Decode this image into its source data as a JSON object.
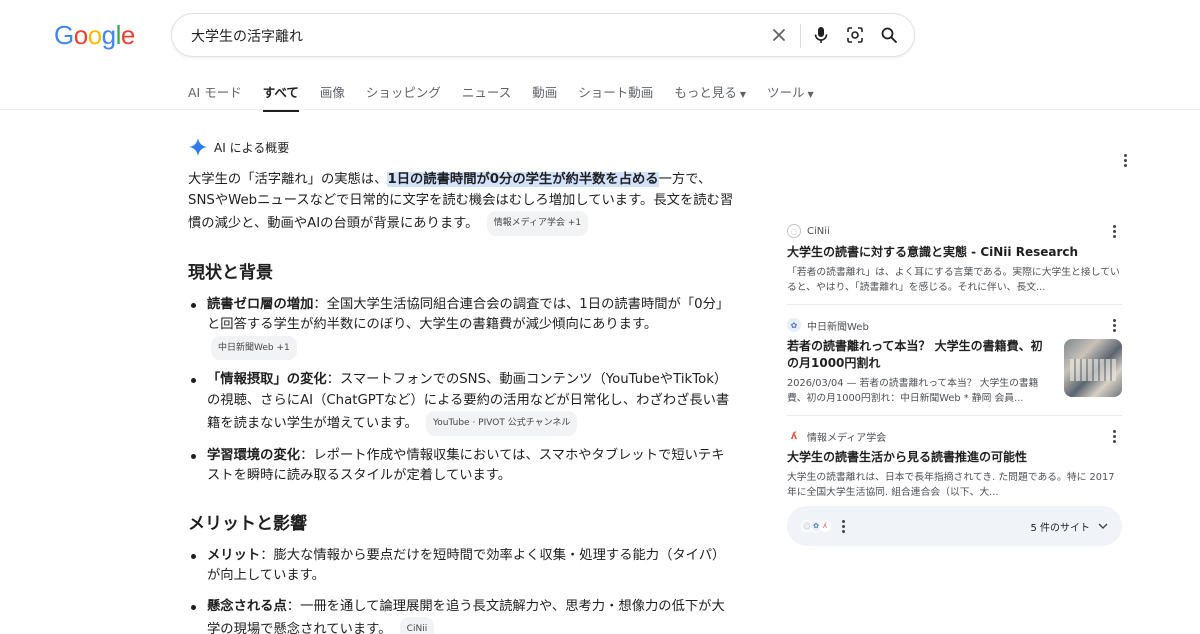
{
  "logo": {
    "text": "Google",
    "colors": [
      "#4285F4",
      "#EA4335",
      "#FBBC05",
      "#4285F4",
      "#34A853",
      "#EA4335"
    ]
  },
  "search": {
    "query": "大学生の活字離れ"
  },
  "tabs": [
    {
      "label": "AI モード"
    },
    {
      "label": "すべて",
      "active": true
    },
    {
      "label": "画像"
    },
    {
      "label": "ショッピング"
    },
    {
      "label": "ニュース"
    },
    {
      "label": "動画"
    },
    {
      "label": "ショート動画"
    },
    {
      "label": "もっと見る"
    },
    {
      "label": "ツール"
    }
  ],
  "ai_overview": {
    "title": "AI による概要",
    "intro_before": "大学生の「活字離れ」の実態は、",
    "intro_highlight": "1日の読書時間が0分の学生が約半数を占める",
    "intro_after": "一方で、SNSやWebニュースなどで日常的に文字を読む機会はむしろ増加しています。長文を読む習慣の減少と、動画やAIの台頭が背景にあります。",
    "intro_chip": "情報メディア学会 +1",
    "section1": {
      "heading": "現状と背景",
      "items": [
        {
          "bold": "読書ゼロ層の増加",
          "text": "：全国大学生活協同組合連合会の調査では、1日の読書時間が「0分」と回答する学生が約半数にのぼり、大学生の書籍費が減少傾向にあります。",
          "chip": "中日新聞Web +1"
        },
        {
          "bold": "「情報摂取」の変化",
          "text": "：スマートフォンでのSNS、動画コンテンツ（YouTubeやTikTok）の視聴、さらにAI（ChatGPTなど）による要約の活用などが日常化し、わざわざ長い書籍を読まない学生が増えています。",
          "chip": "YouTube · PIVOT 公式チャンネル"
        },
        {
          "bold": "学習環境の変化",
          "text": "：レポート作成や情報収集においては、スマホやタブレットで短いテキストを瞬時に読み取るスタイルが定着しています。",
          "chip": ""
        }
      ]
    },
    "section2": {
      "heading": "メリットと影響",
      "items": [
        {
          "bold": "メリット",
          "text": "：膨大な情報から要点だけを短時間で効率よく収集・処理する能力（タイパ）が向上しています。",
          "chip": ""
        },
        {
          "bold": "懸念される点",
          "text": "：一冊を通して論理展開を追う長文読解力や、思考力・想像力の低下が大学の現場で懸念されています。",
          "chip": "CiNii"
        }
      ]
    }
  },
  "sources": [
    {
      "site": "CiNii",
      "title": "大学生の読書に対する意識と実態 - CiNii Research",
      "snippet": "「若者の読書離れ」は、よく耳にする言葉である。実際に大学生と接していると、やはり、「読書離れ」を感じる。それに伴い、長文..."
    },
    {
      "site": "中日新聞Web",
      "title": "若者の読書離れって本当？ 大学生の書籍費、初の月1000円割れ",
      "snippet": "2026/03/04 — 若者の読書離れって本当？ 大学生の書籍費、初の月1000円割れ：中日新聞Web * 静岡 会員..."
    },
    {
      "site": "情報メディア学会",
      "title": "大学生の読書生活から見る読書推進の可能性",
      "snippet": "大学生の読書離れは、日本で長年指摘されてき. た問題である。特に 2017 年に全国大学生活協同. 組合連合会（以下、大..."
    }
  ],
  "more_sites": {
    "label": "5 件のサイト"
  }
}
